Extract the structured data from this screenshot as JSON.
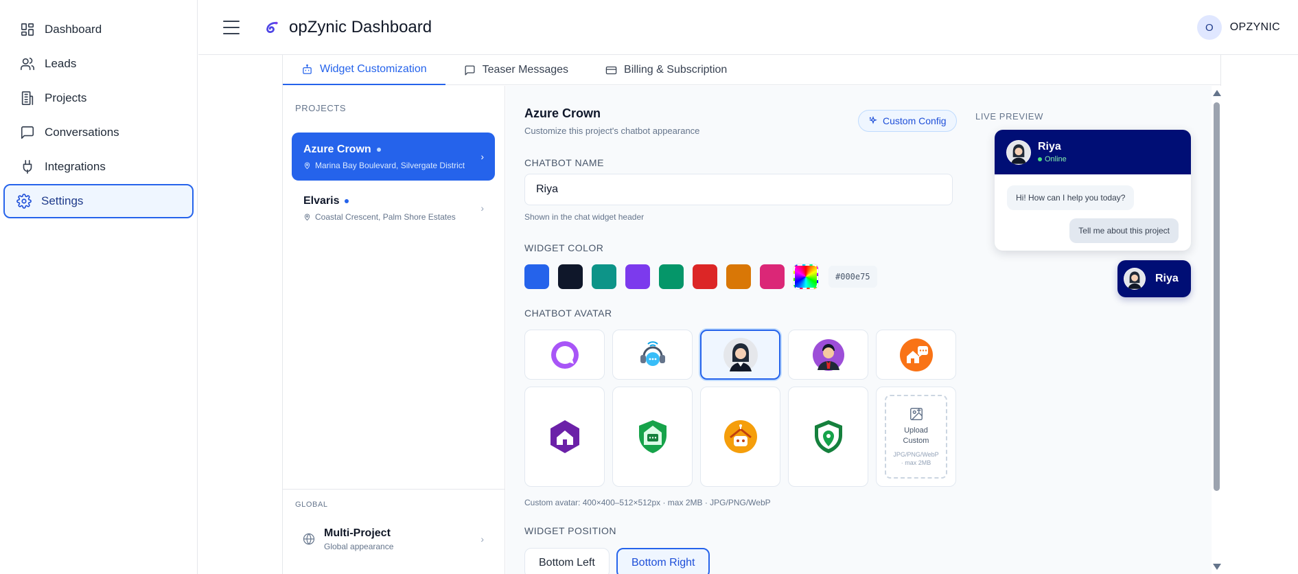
{
  "sidebar": {
    "items": [
      {
        "label": "Dashboard",
        "icon": "dashboard-icon"
      },
      {
        "label": "Leads",
        "icon": "users-icon"
      },
      {
        "label": "Projects",
        "icon": "building-icon"
      },
      {
        "label": "Conversations",
        "icon": "chat-icon"
      },
      {
        "label": "Integrations",
        "icon": "plug-icon"
      },
      {
        "label": "Settings",
        "icon": "gear-icon",
        "active": true
      }
    ]
  },
  "header": {
    "title": "opZynic Dashboard",
    "user_initial": "O",
    "user_name": "OPZYNIC"
  },
  "tabs": [
    {
      "label": "Widget Customization",
      "icon": "bot-icon",
      "active": true
    },
    {
      "label": "Teaser Messages",
      "icon": "message-icon"
    },
    {
      "label": "Billing & Subscription",
      "icon": "credit-card-icon"
    }
  ],
  "projects": {
    "section_label": "PROJECTS",
    "items": [
      {
        "name": "Azure Crown",
        "address": "Marina Bay Boulevard, Silvergate District",
        "active": true
      },
      {
        "name": "Elvaris",
        "address": "Coastal Crescent, Palm Shore Estates"
      }
    ],
    "global_label": "GLOBAL",
    "global_item": {
      "title": "Multi-Project",
      "subtitle": "Global appearance"
    }
  },
  "editor": {
    "title": "Azure Crown",
    "subtitle": "Customize this project's chatbot appearance",
    "custom_config_label": "Custom Config",
    "chatbot_name_label": "CHATBOT NAME",
    "chatbot_name_value": "Riya",
    "chatbot_name_hint": "Shown in the chat widget header",
    "widget_color_label": "WIDGET COLOR",
    "colors": [
      "#2563eb",
      "#0f172a",
      "#0d9488",
      "#7c3aed",
      "#059669",
      "#dc2626",
      "#d97706",
      "#db2777"
    ],
    "selected_color": "#000e75",
    "avatar_label": "CHATBOT AVATAR",
    "avatars": [
      "chat-ring-icon",
      "support-headset-icon",
      "woman-avatar-icon",
      "businessman-avatar-icon",
      "house-chat-icon",
      "house-hexagon-icon",
      "shield-chat-icon",
      "robot-house-icon",
      "shield-pin-icon"
    ],
    "selected_avatar": "woman-avatar-icon",
    "upload_title": "Upload Custom",
    "upload_sub": "JPG/PNG/WebP · max 2MB",
    "avatar_hint": "Custom avatar: 400×400–512×512px · max 2MB · JPG/PNG/WebP",
    "position_label": "WIDGET POSITION",
    "positions": [
      "Bottom Left",
      "Bottom Right"
    ],
    "selected_position": "Bottom Right"
  },
  "preview": {
    "label": "LIVE PREVIEW",
    "bot_name": "Riya",
    "status": "Online",
    "bot_message": "Hi! How can I help you today?",
    "user_message": "Tell me about this project",
    "launcher_name": "Riya",
    "header_color": "#000e75"
  }
}
